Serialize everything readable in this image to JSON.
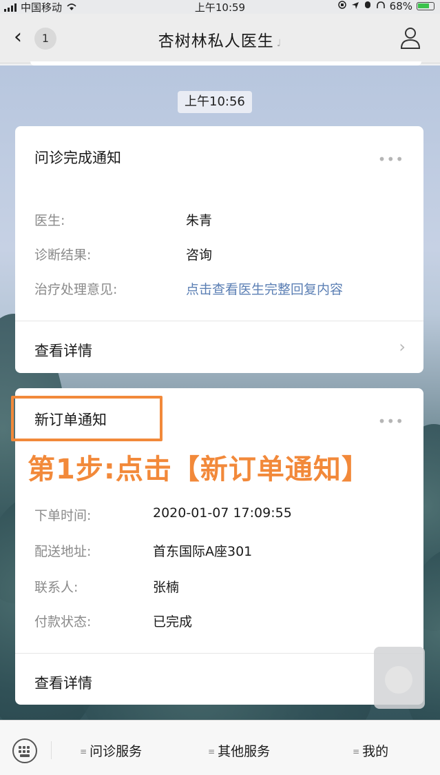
{
  "status_bar": {
    "carrier": "中国移动",
    "time": "上午10:59",
    "battery": "68%"
  },
  "nav": {
    "back_count": "1",
    "title": "杏树林私人医生"
  },
  "chat": {
    "timestamp": "上午10:56"
  },
  "card1": {
    "title": "问诊完成通知",
    "more": "•••",
    "rows": [
      {
        "key": "医生:",
        "value": "朱青"
      },
      {
        "key": "诊断结果:",
        "value": "咨询"
      },
      {
        "key": "治疗处理意见:",
        "value": "点击查看医生完整回复内容"
      }
    ],
    "detail": "查看详情"
  },
  "card2": {
    "title": "新订单通知",
    "more": "•••",
    "rows": [
      {
        "key": "下单时间:",
        "value": "2020-01-07 17:09:55"
      },
      {
        "key": "配送地址:",
        "value": "首东国际A座301"
      },
      {
        "key": "联系人:",
        "value": "张楠"
      },
      {
        "key": "付款状态:",
        "value": "已完成"
      }
    ],
    "detail": "查看详情"
  },
  "annotation": {
    "text": "第1步:点击【新订单通知】",
    "color": "#f2893a"
  },
  "menu": {
    "items": [
      "问诊服务",
      "其他服务",
      "我的"
    ]
  },
  "icons": {
    "back": "chevron-left-icon",
    "user": "user-profile-icon",
    "keyboard": "keyboard-icon",
    "more": "more-dots-icon",
    "chevron": "chevron-right-icon"
  }
}
